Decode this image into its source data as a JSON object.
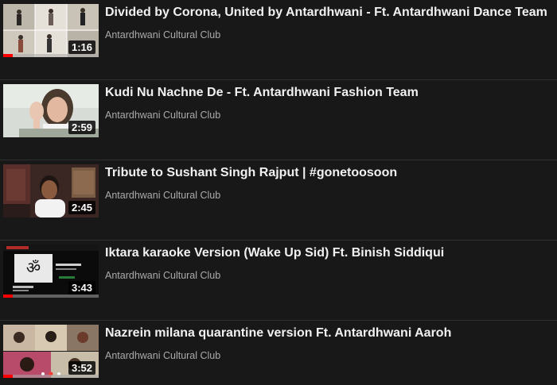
{
  "videos": [
    {
      "title": "Divided by Corona, United by Antardhwani - Ft. Antardhwani Dance Team",
      "channel": "Antardhwani Cultural Club",
      "duration": "1:16",
      "watched_fraction": 0.1,
      "thumbnail": "dance-team-collage"
    },
    {
      "title": "Kudi Nu Nachne De - Ft. Antardhwani Fashion Team",
      "channel": "Antardhwani Cultural Club",
      "duration": "2:59",
      "watched_fraction": 0,
      "thumbnail": "fashion-team-selfie"
    },
    {
      "title": "Tribute to Sushant Singh Rajput | #gonetoosoon",
      "channel": "Antardhwani Cultural Club",
      "duration": "2:45",
      "watched_fraction": 0,
      "thumbnail": "singer-at-home"
    },
    {
      "title": "Iktara karaoke Version (Wake Up Sid) Ft. Binish Siddiqui",
      "channel": "Antardhwani Cultural Club",
      "duration": "3:43",
      "watched_fraction": 0.1,
      "thumbnail": "antardhwani-title-card"
    },
    {
      "title": "Nazrein milana quarantine version Ft. Antardhwani Aaroh",
      "channel": "Antardhwani Cultural Club",
      "duration": "3:52",
      "watched_fraction": 0.1,
      "thumbnail": "video-call-grid"
    }
  ]
}
